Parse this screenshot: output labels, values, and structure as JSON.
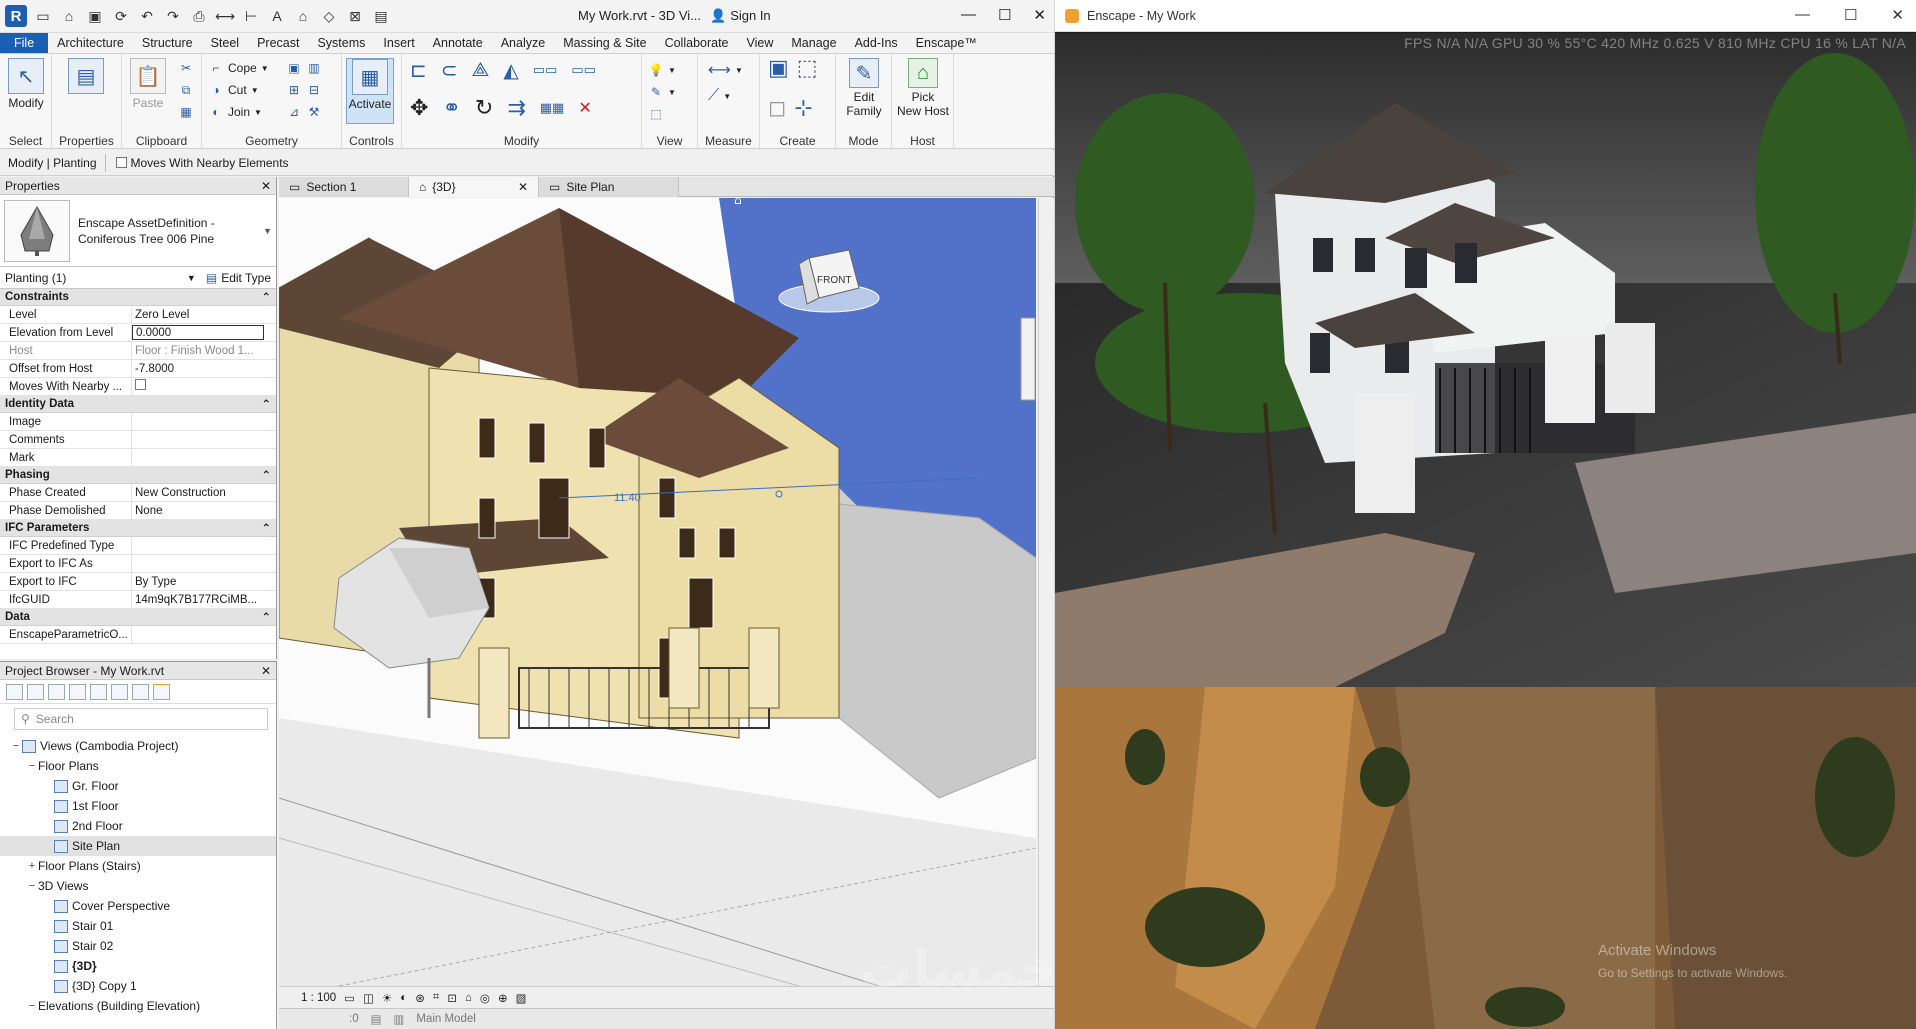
{
  "revit": {
    "title": "My Work.rvt - 3D Vi...",
    "sign_in": "Sign In",
    "tabs": [
      "File",
      "Architecture",
      "Structure",
      "Steel",
      "Precast",
      "Systems",
      "Insert",
      "Annotate",
      "Analyze",
      "Massing & Site",
      "Collaborate",
      "View",
      "Manage",
      "Add-Ins",
      "Enscape™"
    ],
    "ribbon": {
      "select": {
        "modify": "Modify",
        "label": "Select"
      },
      "properties": {
        "label": "Properties"
      },
      "clipboard": {
        "paste": "Paste",
        "label": "Clipboard"
      },
      "geometry": {
        "cope": "Cope",
        "cut": "Cut",
        "join": "Join",
        "label": "Geometry"
      },
      "controls": {
        "activate": "Activate",
        "label": "Controls"
      },
      "modify_label": "Modify",
      "view_label": "View",
      "measure_label": "Measure",
      "create_label": "Create",
      "mode": {
        "edit_family_1": "Edit",
        "edit_family_2": "Family",
        "label": "Mode"
      },
      "host": {
        "pick_1": "Pick",
        "pick_2": "New Host",
        "label": "Host"
      }
    },
    "options_bar": {
      "mode": "Modify | Planting",
      "moves_with": "Moves With Nearby Elements"
    },
    "properties": {
      "header": "Properties",
      "type_name": "Enscape AssetDefinition - Coniferous Tree 006 Pine",
      "instance": "Planting (1)",
      "edit_type": "Edit Type",
      "groups": [
        {
          "name": "Constraints",
          "rows": [
            {
              "k": "Level",
              "v": "Zero Level"
            },
            {
              "k": "Elevation from Level",
              "v": "0.0000",
              "edit": true
            },
            {
              "k": "Host",
              "v": "Floor : Finish Wood 1...",
              "dim": true
            },
            {
              "k": "Offset from Host",
              "v": "-7.8000"
            },
            {
              "k": "Moves With Nearby ...",
              "v": "",
              "check": true
            }
          ]
        },
        {
          "name": "Identity Data",
          "rows": [
            {
              "k": "Image",
              "v": ""
            },
            {
              "k": "Comments",
              "v": ""
            },
            {
              "k": "Mark",
              "v": ""
            }
          ]
        },
        {
          "name": "Phasing",
          "rows": [
            {
              "k": "Phase Created",
              "v": "New Construction"
            },
            {
              "k": "Phase Demolished",
              "v": "None"
            }
          ]
        },
        {
          "name": "IFC Parameters",
          "rows": [
            {
              "k": "IFC Predefined Type",
              "v": ""
            },
            {
              "k": "Export to IFC As",
              "v": ""
            },
            {
              "k": "Export to IFC",
              "v": "By Type"
            },
            {
              "k": "IfcGUID",
              "v": "14m9qK7B177RCiMB..."
            }
          ]
        },
        {
          "name": "Data",
          "rows": [
            {
              "k": "EnscapeParametricO...",
              "v": ""
            }
          ]
        }
      ]
    },
    "browser": {
      "header": "Project Browser - My Work.rvt",
      "search_placeholder": "Search",
      "items": [
        {
          "text": "Views (Cambodia Project)",
          "level": 0,
          "tw": "−",
          "icon": true
        },
        {
          "text": "Floor Plans",
          "level": 1,
          "tw": "−"
        },
        {
          "text": "Gr. Floor",
          "level": 2,
          "icon": true
        },
        {
          "text": "1st Floor",
          "level": 2,
          "icon": true
        },
        {
          "text": "2nd Floor",
          "level": 2,
          "icon": true
        },
        {
          "text": "Site Plan",
          "level": 2,
          "icon": true,
          "sel": true
        },
        {
          "text": "Floor Plans (Stairs)",
          "level": 1,
          "tw": "+"
        },
        {
          "text": "3D Views",
          "level": 1,
          "tw": "−"
        },
        {
          "text": "Cover Perspective",
          "level": 2,
          "icon": true
        },
        {
          "text": "Stair 01",
          "level": 2,
          "icon": true
        },
        {
          "text": "Stair 02",
          "level": 2,
          "icon": true
        },
        {
          "text": "{3D}",
          "level": 2,
          "icon": true,
          "bold": true
        },
        {
          "text": "{3D} Copy 1",
          "level": 2,
          "icon": true
        },
        {
          "text": "Elevations (Building Elevation)",
          "level": 1,
          "tw": "−"
        }
      ]
    },
    "view_tabs": [
      {
        "label": "Section 1",
        "active": false
      },
      {
        "label": "{3D}",
        "active": true
      },
      {
        "label": "Site Plan",
        "active": false
      }
    ],
    "viewcube_face": "FRONT",
    "dimension_text": "11.40",
    "scale": "1 : 100",
    "status_zero": ":0",
    "status_model": "Main Model"
  },
  "enscape": {
    "title": "Enscape - My Work",
    "stats": "FPS N/A N/A GPU 30 % 55°C 420 MHz 0.625 V 810 MHz CPU 16 % LAT N/A"
  },
  "overlay": {
    "watermark": "خمسات",
    "activate_1": "Activate Windows",
    "activate_2": "Go to Settings to activate Windows."
  }
}
